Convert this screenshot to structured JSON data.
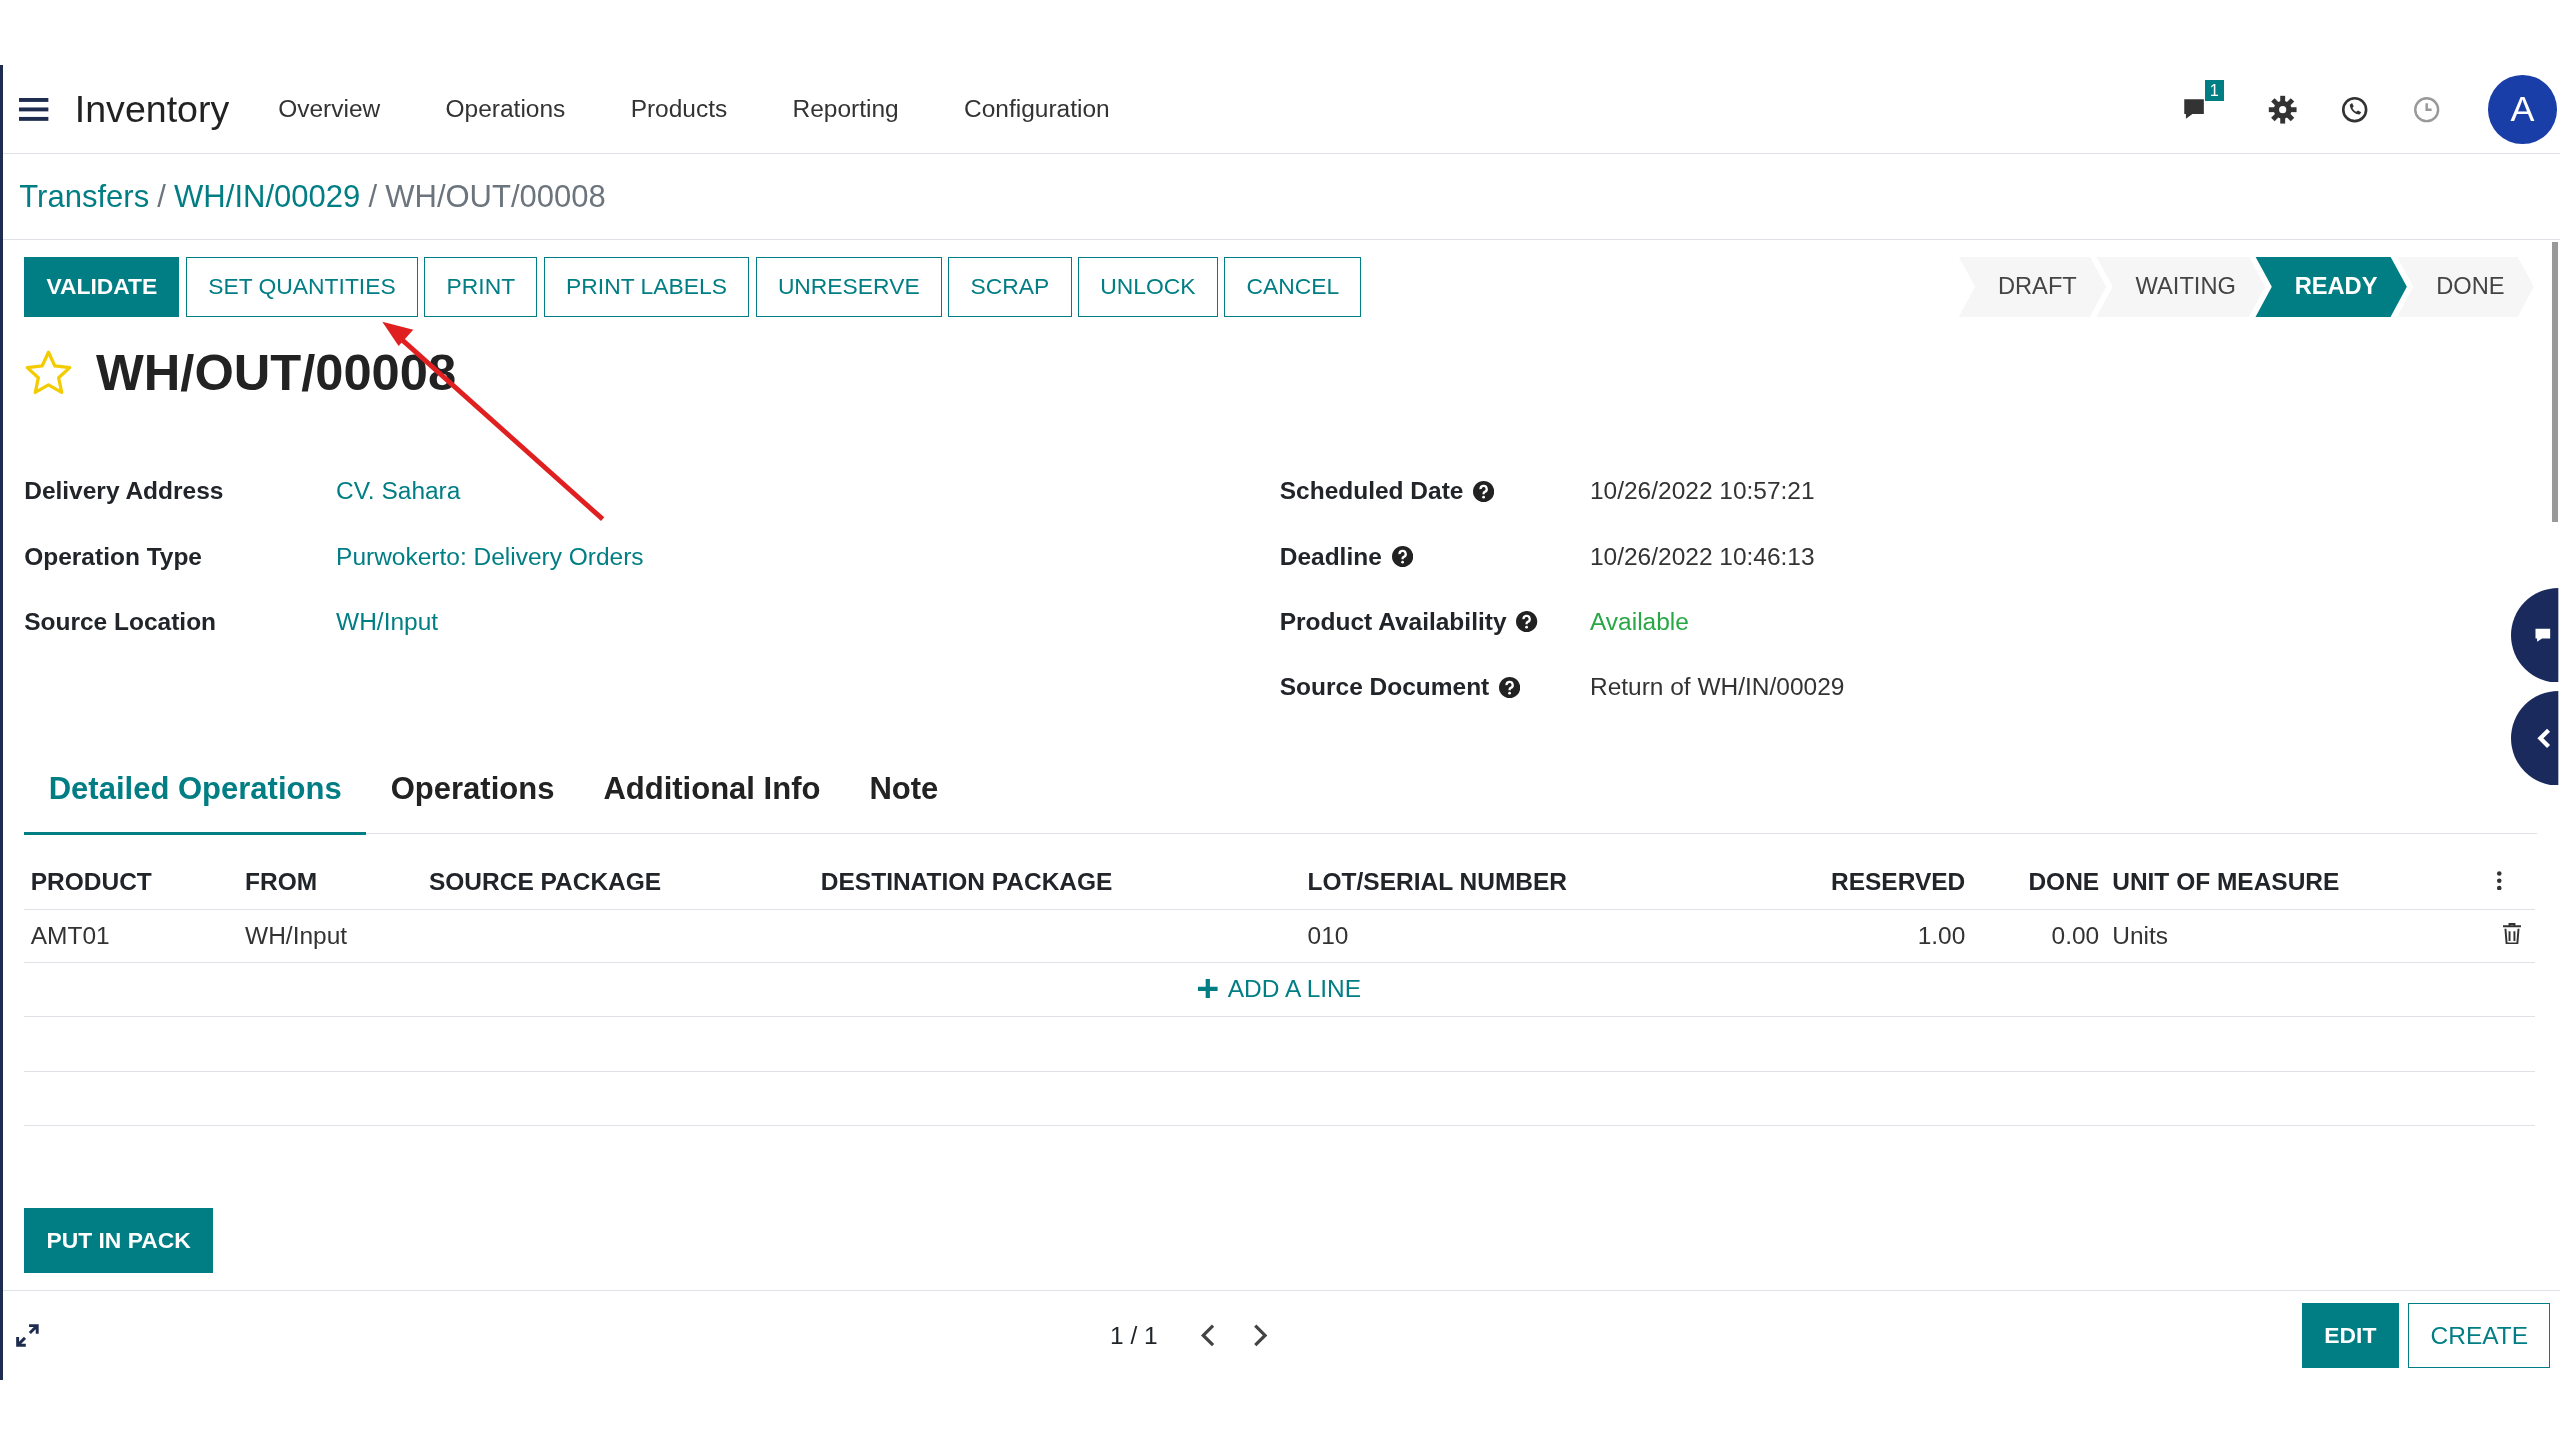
{
  "navbar": {
    "app_name": "Inventory",
    "menu": [
      "Overview",
      "Operations",
      "Products",
      "Reporting",
      "Configuration"
    ],
    "message_count": "1",
    "avatar_letter": "A"
  },
  "breadcrumb": [
    {
      "label": "Transfers",
      "kind": "link"
    },
    {
      "label": "/",
      "kind": "separator"
    },
    {
      "label": "WH/IN/00029",
      "kind": "link"
    },
    {
      "label": "/",
      "kind": "separator"
    },
    {
      "label": "WH/OUT/00008",
      "kind": "current"
    }
  ],
  "actions": [
    {
      "label": "VALIDATE",
      "primary": true
    },
    {
      "label": "SET QUANTITIES",
      "primary": false
    },
    {
      "label": "PRINT",
      "primary": false
    },
    {
      "label": "PRINT LABELS",
      "primary": false
    },
    {
      "label": "UNRESERVE",
      "primary": false
    },
    {
      "label": "SCRAP",
      "primary": false
    },
    {
      "label": "UNLOCK",
      "primary": false
    },
    {
      "label": "CANCEL",
      "primary": false
    }
  ],
  "stages": [
    {
      "label": "DRAFT",
      "selected": false
    },
    {
      "label": "WAITING",
      "selected": false
    },
    {
      "label": "READY",
      "selected": true
    },
    {
      "label": "DONE",
      "selected": false
    }
  ],
  "record": {
    "title": "WH/OUT/00008",
    "favorite": false
  },
  "fields_left": [
    {
      "label": "Delivery Address",
      "value": "CV. Sahara",
      "kind": "link"
    },
    {
      "label": "Operation Type",
      "value": "Purwokerto: Delivery Orders",
      "kind": "link"
    },
    {
      "label": "Source Location",
      "value": "WH/Input",
      "kind": "link"
    }
  ],
  "fields_right": [
    {
      "label": "Scheduled Date",
      "value": "10/26/2022 10:57:21",
      "kind": "text",
      "help": true
    },
    {
      "label": "Deadline",
      "value": "10/26/2022 10:46:13",
      "kind": "text",
      "help": true
    },
    {
      "label": "Product Availability",
      "value": "Available",
      "kind": "status",
      "help": true
    },
    {
      "label": "Source Document",
      "value": "Return of WH/IN/00029",
      "kind": "text",
      "help": true
    }
  ],
  "tabs": [
    {
      "label": "Detailed Operations",
      "selected": true
    },
    {
      "label": "Operations",
      "selected": false
    },
    {
      "label": "Additional Info",
      "selected": false
    },
    {
      "label": "Note",
      "selected": false
    }
  ],
  "table": {
    "columns": [
      "PRODUCT",
      "FROM",
      "SOURCE PACKAGE",
      "DESTINATION PACKAGE",
      "LOT/SERIAL NUMBER",
      "RESERVED",
      "DONE",
      "UNIT OF MEASURE"
    ],
    "rows": [
      [
        "AMT01",
        "WH/Input",
        "",
        "",
        "010",
        "1.00",
        "0.00",
        "Units"
      ]
    ],
    "add_line": "ADD A LINE"
  },
  "put_in_pack": "PUT IN PACK",
  "footer": {
    "pager": "1 / 1",
    "buttons": [
      {
        "label": "EDIT",
        "primary": true
      },
      {
        "label": "CREATE",
        "primary": false
      }
    ]
  }
}
